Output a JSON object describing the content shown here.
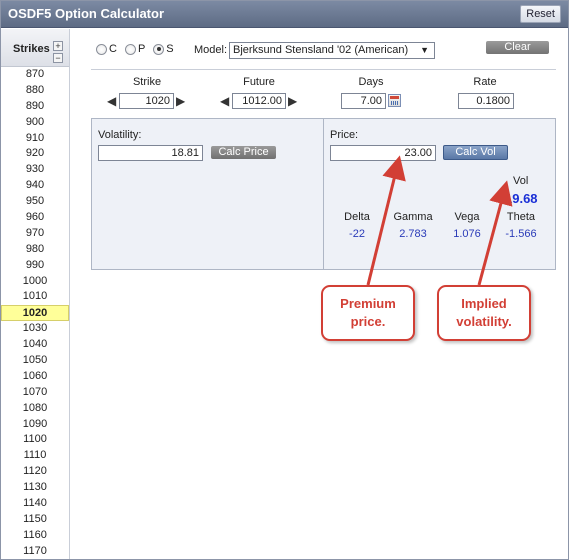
{
  "app": {
    "title": "OSDF5 Option Calculator",
    "reset_label": "Reset"
  },
  "strikes": {
    "title": "Strikes",
    "plus": "+",
    "minus": "−",
    "items": [
      "870",
      "880",
      "890",
      "900",
      "910",
      "920",
      "930",
      "940",
      "950",
      "960",
      "970",
      "980",
      "990",
      "1000",
      "1010",
      "1020",
      "1030",
      "1040",
      "1050",
      "1060",
      "1070",
      "1080",
      "1090",
      "1100",
      "1110",
      "1120",
      "1130",
      "1140",
      "1150",
      "1160",
      "1170"
    ],
    "selected": "1020"
  },
  "options": {
    "radios": [
      {
        "label": "C",
        "checked": false
      },
      {
        "label": "P",
        "checked": false
      },
      {
        "label": "S",
        "checked": true
      }
    ],
    "model_label": "Model:",
    "model_value": "Bjerksund Stensland '02 (American)",
    "clear_label": "Clear"
  },
  "params": {
    "strike": {
      "label": "Strike",
      "value": "1020"
    },
    "future": {
      "label": "Future",
      "value": "1012.00"
    },
    "days": {
      "label": "Days",
      "value": "7.00"
    },
    "rate": {
      "label": "Rate",
      "value": "0.1800"
    }
  },
  "volatility": {
    "label": "Volatility:",
    "value": "18.81",
    "button": "Calc Price"
  },
  "price": {
    "label": "Price:",
    "value": "23.00",
    "button": "Calc Vol"
  },
  "results": {
    "vol_label": "Vol",
    "vol_value": "19.68",
    "greeks": [
      {
        "name": "Delta",
        "value": "-22"
      },
      {
        "name": "Gamma",
        "value": "2.783"
      },
      {
        "name": "Vega",
        "value": "1.076"
      },
      {
        "name": "Theta",
        "value": "-1.566"
      }
    ]
  },
  "annotations": {
    "premium": "Premium price.",
    "implied": "Implied volatility."
  },
  "colors": {
    "accent": "#1a2fd6",
    "callout": "#d23f35",
    "selected_strike": "#ffff99"
  }
}
